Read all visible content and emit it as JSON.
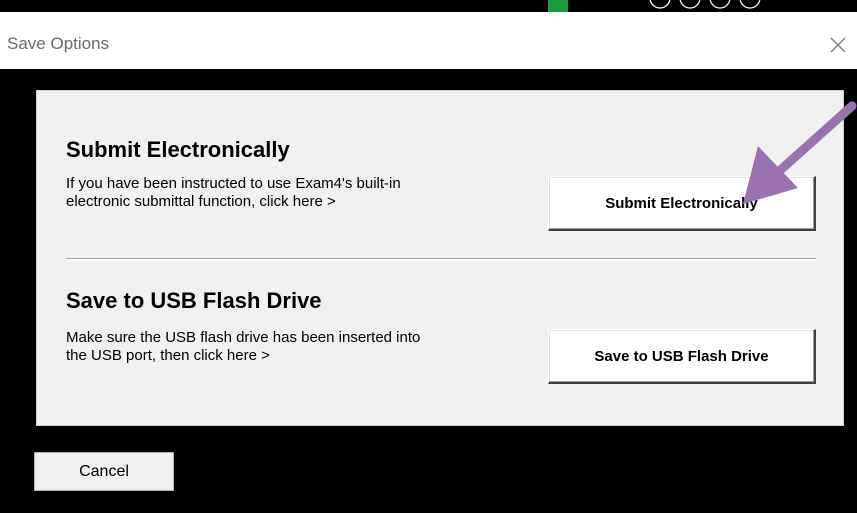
{
  "window": {
    "title": "Save Options",
    "close_icon": "close-icon"
  },
  "submit_section": {
    "heading": "Submit Electronically",
    "description_line1": "If you have been instructed to use Exam4's built-in",
    "description_line2": "electronic submittal function, click here >",
    "button_label": "Submit Electronically"
  },
  "usb_section": {
    "heading": "Save to USB Flash Drive",
    "description_line1": "Make sure the USB flash drive has been inserted into",
    "description_line2": "the USB port, then click here >",
    "button_label": "Save to USB Flash Drive"
  },
  "footer": {
    "cancel_label": "Cancel"
  },
  "annotation": {
    "arrow_color": "#9b72b0",
    "arrow_icon": "pointer-arrow-icon"
  },
  "colors": {
    "panel_bg": "#f0f0f0",
    "window_bg": "#000000",
    "titlebar_bg": "#ffffff"
  }
}
